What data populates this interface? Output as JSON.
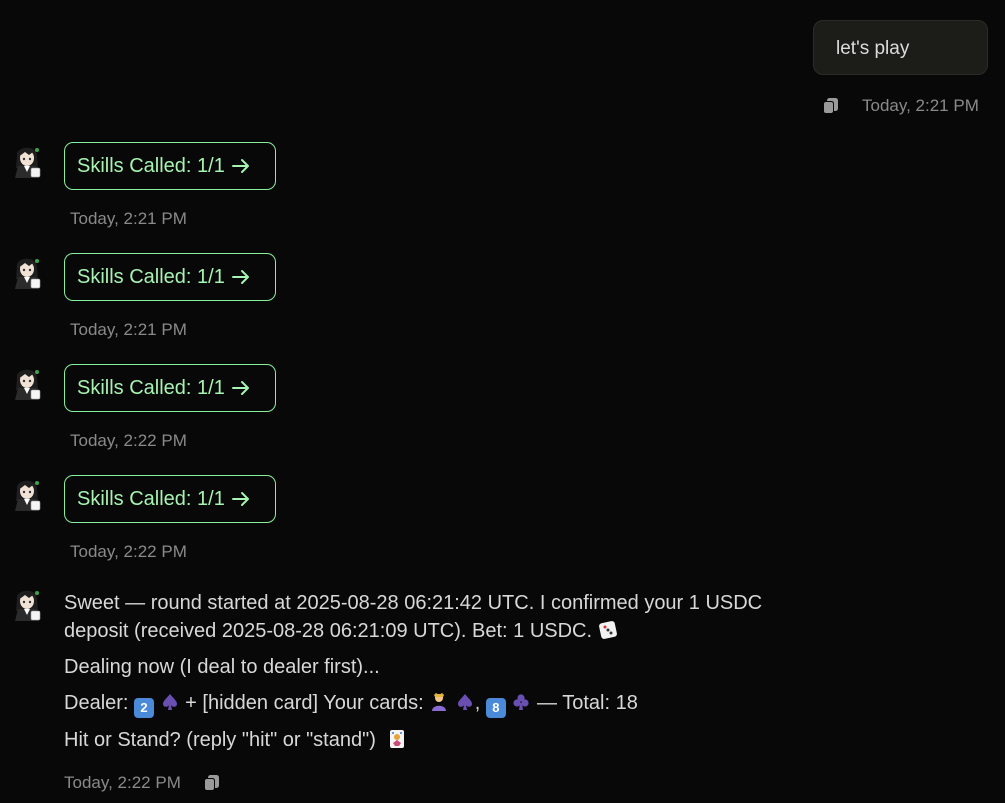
{
  "user_message": {
    "text": "let's play",
    "timestamp": "Today, 2:21 PM",
    "copy_icon": "copy-icon"
  },
  "skill_messages": [
    {
      "label": "Skills Called: 1/1",
      "timestamp": "Today, 2:21 PM"
    },
    {
      "label": "Skills Called: 1/1",
      "timestamp": "Today, 2:21 PM"
    },
    {
      "label": "Skills Called: 1/1",
      "timestamp": "Today, 2:22 PM"
    },
    {
      "label": "Skills Called: 1/1",
      "timestamp": "Today, 2:22 PM"
    }
  ],
  "assistant_reply": {
    "line1": "Sweet — round started at 2025-08-28 06:21:42 UTC. I confirmed your 1 USDC deposit (received 2025-08-28 06:21:09 UTC). Bet: 1 USDC.",
    "line2": "Dealing now (I deal to dealer first)...",
    "line3_a": "Dealer:",
    "dealer_card_value": "2",
    "line3_b": "+ [hidden card] Your cards:",
    "player_card_value": "8",
    "line3_c": "— Total: 18",
    "line4": "Hit or Stand? (reply \"hit\" or \"stand\")",
    "timestamp": "Today, 2:22 PM"
  },
  "colors": {
    "background": "#080808",
    "chip_border": "#86ef9a",
    "chip_text": "#a7f3b2",
    "timestamp": "#8a8a8a"
  }
}
